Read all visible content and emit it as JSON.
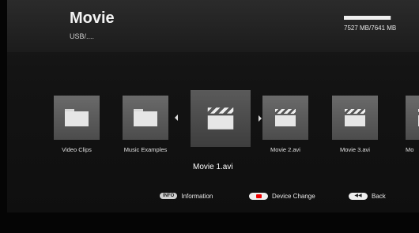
{
  "header": {
    "title": "Movie",
    "path": "USB/....",
    "storage": {
      "text": "7527 MB/7641 MB",
      "used_fraction": 0.985
    }
  },
  "items": [
    {
      "label": "Video Clips",
      "type": "folder"
    },
    {
      "label": "Music Examples",
      "type": "folder"
    },
    {
      "label": "Movie 1.avi",
      "type": "movie",
      "selected": true
    },
    {
      "label": "Movie 2.avi",
      "type": "movie"
    },
    {
      "label": "Movie 3.avi",
      "type": "movie"
    },
    {
      "label": "Mo",
      "type": "movie"
    }
  ],
  "selected_label": "Movie 1.avi",
  "footer": {
    "info_button": "INFO",
    "info_label": "Information",
    "device_label": "Device Change",
    "back_button_icon": "rewind-icon",
    "back_label": "Back"
  }
}
